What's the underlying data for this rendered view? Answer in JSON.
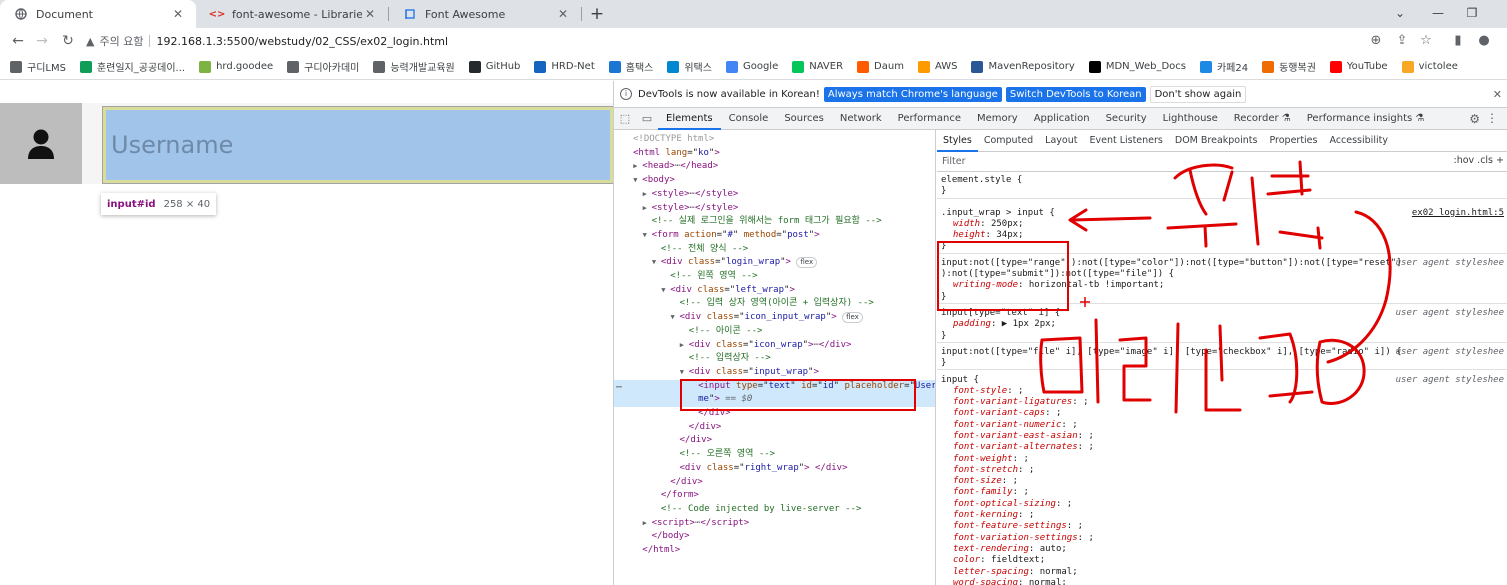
{
  "browser": {
    "tabs": [
      {
        "title": "Document",
        "favicon": "globe-icon",
        "active": true
      },
      {
        "title": "font-awesome - Libraries - cdnj",
        "favicon": "code-icon",
        "active": false
      },
      {
        "title": "Font Awesome",
        "favicon": "flag-icon",
        "active": false
      }
    ],
    "new_tab": "+",
    "window_controls": {
      "chevron": "⌄",
      "minimize": "—",
      "restore": "❐"
    },
    "address": {
      "security_label": "주의 요함",
      "url": "192.168.1.3:5500/webstudy/02_CSS/ex02_login.html"
    },
    "bookmarks": [
      {
        "label": "구디LMS",
        "icon": "globe-icon",
        "color": "#5f6368"
      },
      {
        "label": "훈련일지_공공데이...",
        "icon": "sheet-icon",
        "color": "#0f9d58"
      },
      {
        "label": "hrd.goodee",
        "icon": "leaf-icon",
        "color": "#7cb342"
      },
      {
        "label": "구디아카데미",
        "icon": "globe-icon",
        "color": "#5f6368"
      },
      {
        "label": "능력개발교육원",
        "icon": "globe-icon",
        "color": "#5f6368"
      },
      {
        "label": "GitHub",
        "icon": "github-icon",
        "color": "#24292e"
      },
      {
        "label": "HRD-Net",
        "icon": "hrdnet-icon",
        "color": "#1565c0"
      },
      {
        "label": "홈택스",
        "icon": "hometax-icon",
        "color": "#1976d2"
      },
      {
        "label": "위택스",
        "icon": "wetax-icon",
        "color": "#0288d1"
      },
      {
        "label": "Google",
        "icon": "google-icon",
        "color": "#4285f4"
      },
      {
        "label": "NAVER",
        "icon": "naver-icon",
        "color": "#03c75a"
      },
      {
        "label": "Daum",
        "icon": "daum-icon",
        "color": "#ff5a00"
      },
      {
        "label": "AWS",
        "icon": "aws-icon",
        "color": "#ff9900"
      },
      {
        "label": "MavenRepository",
        "icon": "maven-icon",
        "color": "#2b5797"
      },
      {
        "label": "MDN_Web_Docs",
        "icon": "mdn-icon",
        "color": "#000000"
      },
      {
        "label": "카페24",
        "icon": "cafe24-icon",
        "color": "#1e88e5"
      },
      {
        "label": "동행복권",
        "icon": "lottery-icon",
        "color": "#ef6c00"
      },
      {
        "label": "YouTube",
        "icon": "youtube-icon",
        "color": "#ff0000"
      },
      {
        "label": "victolee",
        "icon": "v-icon",
        "color": "#f9a825"
      }
    ]
  },
  "page": {
    "username_placeholder": "Username",
    "inspect_tooltip": {
      "tag": "input#id",
      "size": "258 × 40"
    }
  },
  "devtools": {
    "info_bar": {
      "message": "DevTools is now available in Korean!",
      "btn_match": "Always match Chrome's language",
      "btn_switch": "Switch DevTools to Korean",
      "btn_dismiss": "Don't show again"
    },
    "tabs": [
      "Elements",
      "Console",
      "Sources",
      "Network",
      "Performance",
      "Memory",
      "Application",
      "Security",
      "Lighthouse",
      "Recorder ⚗",
      "Performance insights ⚗"
    ],
    "dom_lines": [
      {
        "indent": 0,
        "arrow": "",
        "html": "<span class='doctype'>&lt;!DOCTYPE html&gt;</span>"
      },
      {
        "indent": 0,
        "arrow": "",
        "html": "<span class='tag'>&lt;html</span> <span class='attr'>lang</span>=\"<span class='val'>ko</span>\"<span class='tag'>&gt;</span>"
      },
      {
        "indent": 1,
        "arrow": "▶",
        "html": "<span class='tag'>&lt;head&gt;</span><span class='ellipsis'>⋯</span><span class='tag'>&lt;/head&gt;</span>"
      },
      {
        "indent": 1,
        "arrow": "▼",
        "html": "<span class='tag'>&lt;body&gt;</span>"
      },
      {
        "indent": 2,
        "arrow": "▶",
        "html": "<span class='tag'>&lt;style&gt;</span><span class='ellipsis'>⋯</span><span class='tag'>&lt;/style&gt;</span>"
      },
      {
        "indent": 2,
        "arrow": "▶",
        "html": "<span class='tag'>&lt;style&gt;</span><span class='ellipsis'>⋯</span><span class='tag'>&lt;/style&gt;</span>"
      },
      {
        "indent": 2,
        "arrow": "",
        "html": "<span class='comment'>&lt;!-- 실제 로그인을 위해서는 form 태그가 필요함 --&gt;</span>"
      },
      {
        "indent": 2,
        "arrow": "▼",
        "html": "<span class='tag'>&lt;form</span> <span class='attr'>action</span>=\"<span class='val'>#</span>\" <span class='attr'>method</span>=\"<span class='val'>post</span>\"<span class='tag'>&gt;</span>"
      },
      {
        "indent": 3,
        "arrow": "",
        "html": "<span class='comment'>&lt;!-- 전체 양식 --&gt;</span>"
      },
      {
        "indent": 3,
        "arrow": "▼",
        "html": "<span class='tag'>&lt;div</span> <span class='attr'>class</span>=\"<span class='val'>login_wrap</span>\"<span class='tag'>&gt;</span> <span class='badge'>flex</span>"
      },
      {
        "indent": 4,
        "arrow": "",
        "html": "<span class='comment'>&lt;!-- 왼쪽 영역 --&gt;</span>"
      },
      {
        "indent": 4,
        "arrow": "▼",
        "html": "<span class='tag'>&lt;div</span> <span class='attr'>class</span>=\"<span class='val'>left_wrap</span>\"<span class='tag'>&gt;</span>"
      },
      {
        "indent": 5,
        "arrow": "",
        "html": "<span class='comment'>&lt;!-- 입력 상자 영역(아이콘 + 입력상자) --&gt;</span>"
      },
      {
        "indent": 5,
        "arrow": "▼",
        "html": "<span class='tag'>&lt;div</span> <span class='attr'>class</span>=\"<span class='val'>icon_input_wrap</span>\"<span class='tag'>&gt;</span> <span class='badge'>flex</span>"
      },
      {
        "indent": 6,
        "arrow": "",
        "html": "<span class='comment'>&lt;!-- 아이콘 --&gt;</span>"
      },
      {
        "indent": 6,
        "arrow": "▶",
        "html": "<span class='tag'>&lt;div</span> <span class='attr'>class</span>=\"<span class='val'>icon_wrap</span>\"<span class='tag'>&gt;</span><span class='ellipsis'>⋯</span><span class='tag'>&lt;/div&gt;</span>"
      },
      {
        "indent": 6,
        "arrow": "",
        "html": "<span class='comment'>&lt;!-- 입력상자 --&gt;</span>"
      },
      {
        "indent": 6,
        "arrow": "▼",
        "html": "<span class='tag'>&lt;div</span> <span class='attr'>class</span>=\"<span class='val'>input_wrap</span>\"<span class='tag'>&gt;</span>"
      },
      {
        "indent": 7,
        "arrow": "",
        "html": "<span class='tag'>&lt;input</span> <span class='attr'>type</span>=\"<span class='val'>text</span>\" <span class='attr'>id</span>=\"<span class='val'>id</span>\" <span class='attr'>placeholder</span>=\"<span class='val'>Userna</span>",
        "selected": true
      },
      {
        "indent": 7,
        "arrow": "",
        "html": "<span class='val'>me</span>\"<span class='tag'>&gt;</span> <span class='eq'>== $0</span>",
        "selected": true
      },
      {
        "indent": 7,
        "arrow": "",
        "html": "<span class='tag'>&lt;/div&gt;</span>"
      },
      {
        "indent": 6,
        "arrow": "",
        "html": "<span class='tag'>&lt;/div&gt;</span>"
      },
      {
        "indent": 5,
        "arrow": "",
        "html": "<span class='tag'>&lt;/div&gt;</span>"
      },
      {
        "indent": 5,
        "arrow": "",
        "html": "<span class='comment'>&lt;!-- 오른쪽 영역 --&gt;</span>"
      },
      {
        "indent": 5,
        "arrow": "",
        "html": "<span class='tag'>&lt;div</span> <span class='attr'>class</span>=\"<span class='val'>right_wrap</span>\"<span class='tag'>&gt;</span> <span class='tag'>&lt;/div&gt;</span>"
      },
      {
        "indent": 4,
        "arrow": "",
        "html": "<span class='tag'>&lt;/div&gt;</span>"
      },
      {
        "indent": 3,
        "arrow": "",
        "html": "<span class='tag'>&lt;/form&gt;</span>"
      },
      {
        "indent": 3,
        "arrow": "",
        "html": "<span class='comment'>&lt;!-- Code injected by live-server --&gt;</span>"
      },
      {
        "indent": 2,
        "arrow": "▶",
        "html": "<span class='tag'>&lt;script&gt;</span><span class='ellipsis'>⋯</span><span class='tag'>&lt;/script&gt;</span>"
      },
      {
        "indent": 2,
        "arrow": "",
        "html": "<span class='tag'>&lt;/body&gt;</span>"
      },
      {
        "indent": 1,
        "arrow": "",
        "html": "<span class='tag'>&lt;/html&gt;</span>"
      }
    ],
    "styles_tabs": [
      "Styles",
      "Computed",
      "Layout",
      "Event Listeners",
      "DOM Breakpoints",
      "Properties",
      "Accessibility"
    ],
    "filter_placeholder": "Filter",
    "filter_tools": ":hov  .cls  +",
    "rules": [
      {
        "selector": "element.style {",
        "source": "",
        "props": [],
        "close": "}"
      },
      {
        "selector": ".input_wrap > input {",
        "source": "ex02_login.html:5",
        "link": true,
        "props": [
          [
            "width",
            "250px;"
          ],
          [
            "height",
            "34px;"
          ]
        ],
        "close": "}"
      },
      {
        "selector": "input:not([type=\"range\"]):not([type=\"color\"]):not([type=\"button\"]):not([type=\"reset\"]",
        "selector2": "):not([type=\"submit\"]):not([type=\"file\"]) {",
        "source": "user agent styleshee",
        "props": [
          [
            "writing-mode",
            "horizontal-tb !important;"
          ]
        ],
        "close": "}"
      },
      {
        "selector": "input[type=\"text\" i] {",
        "source": "user agent styleshee",
        "props": [
          [
            "padding",
            "▶ 1px 2px;"
          ]
        ],
        "close": "}"
      },
      {
        "selector": "input:not([type=\"file\" i], [type=\"image\" i], [type=\"checkbox\" i], [type=\"radio\" i]) {",
        "source": "user agent styleshee",
        "props": [],
        "close": "}"
      },
      {
        "selector": "input {",
        "source": "user agent styleshee",
        "props": [
          [
            "font-style",
            ";"
          ],
          [
            "font-variant-ligatures",
            ";"
          ],
          [
            "font-variant-caps",
            ";"
          ],
          [
            "font-variant-numeric",
            ";"
          ],
          [
            "font-variant-east-asian",
            ";"
          ],
          [
            "font-variant-alternates",
            ";"
          ],
          [
            "font-weight",
            ";"
          ],
          [
            "font-stretch",
            ";"
          ],
          [
            "font-size",
            ";"
          ],
          [
            "font-family",
            ";"
          ],
          [
            "font-optical-sizing",
            ";"
          ],
          [
            "font-kerning",
            ";"
          ],
          [
            "font-feature-settings",
            ";"
          ],
          [
            "font-variation-settings",
            ";"
          ],
          [
            "text-rendering",
            "auto;"
          ],
          [
            "color",
            "fieldtext;"
          ],
          [
            "letter-spacing",
            "normal;"
          ],
          [
            "word-spacing",
            "normal;"
          ]
        ],
        "close": ""
      }
    ]
  },
  "colors": {
    "accent": "#1a73e8",
    "annotation": "#e00000",
    "input_bg": "#a0c4ea"
  }
}
